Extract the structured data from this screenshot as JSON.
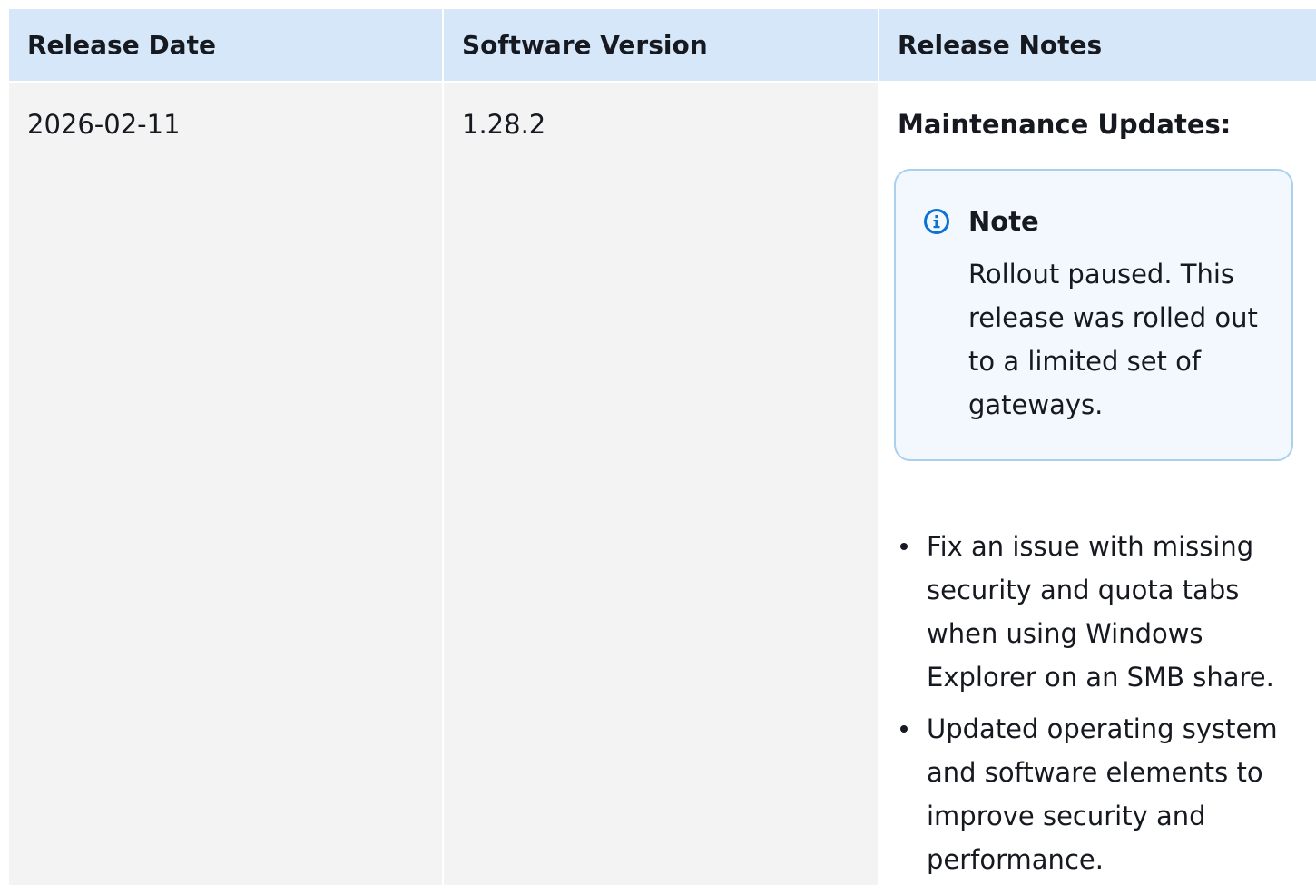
{
  "table": {
    "headers": [
      "Release Date",
      "Software Version",
      "Release Notes"
    ],
    "row": {
      "release_date": "2026-02-11",
      "software_version": "1.28.2",
      "notes_heading": "Maintenance Updates:",
      "note": {
        "title": "Note",
        "icon": "info-icon",
        "body": "Rollout paused. This release was rolled out to a limited set of gateways."
      },
      "updates": [
        "Fix an issue with missing security and quota tabs when using Windows Explorer on an SMB share.",
        "Updated operating system and software elements to improve security and performance."
      ]
    }
  },
  "colors": {
    "header_bg": "#d5e7f8",
    "cell_bg": "#f3f3f3",
    "note_border": "#a9d1ee",
    "note_bg": "#f2f8fd",
    "info_icon": "#0972d3"
  }
}
